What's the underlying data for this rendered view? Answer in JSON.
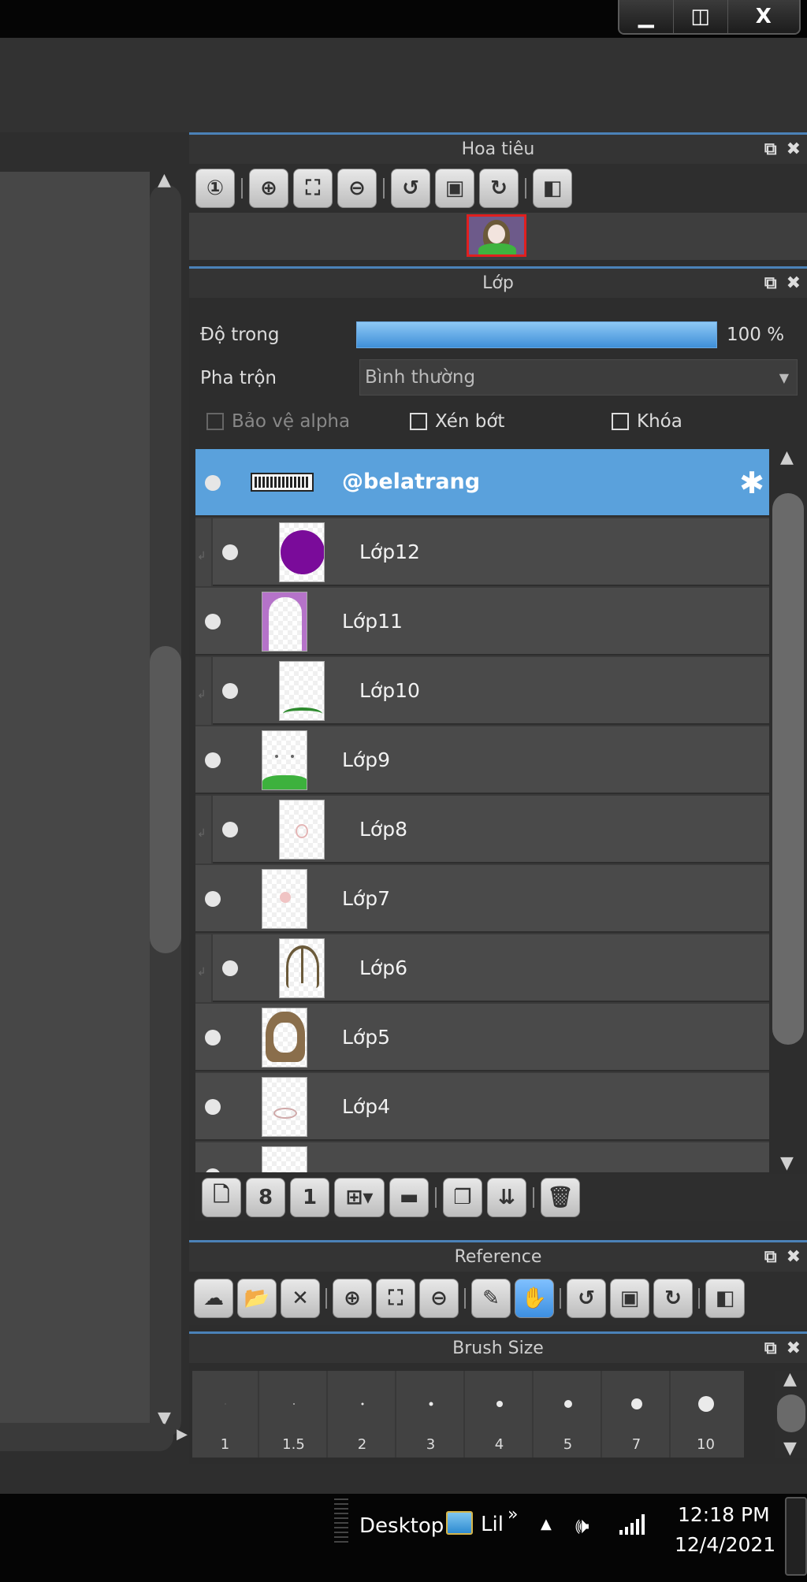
{
  "window": {
    "minimize": "▁",
    "maximize": "◫",
    "close": "X"
  },
  "navigator": {
    "title": "Hoa tiêu"
  },
  "layers": {
    "title": "Lớp",
    "opacity_label": "Độ trong",
    "opacity_value": "100 %",
    "opacity_fraction": 1.0,
    "blend_label": "Pha trộn",
    "blend_value": "Bình thường",
    "protect_alpha": "Bảo vệ alpha",
    "clipping": "Xén bớt",
    "lock": "Khóa",
    "items": [
      {
        "name": "@belatrang",
        "selected": true,
        "clip": false
      },
      {
        "name": "Lớp12",
        "clip": true
      },
      {
        "name": "Lớp11",
        "clip": false
      },
      {
        "name": "Lớp10",
        "clip": true
      },
      {
        "name": "Lớp9",
        "clip": false
      },
      {
        "name": "Lớp8",
        "clip": true
      },
      {
        "name": "Lớp7",
        "clip": false
      },
      {
        "name": "Lớp6",
        "clip": true
      },
      {
        "name": "Lớp5",
        "clip": false
      },
      {
        "name": "Lớp4",
        "clip": false
      }
    ]
  },
  "reference": {
    "title": "Reference"
  },
  "brush_size": {
    "title": "Brush Size",
    "sizes": [
      "1",
      "1.5",
      "2",
      "3",
      "4",
      "5",
      "7",
      "10"
    ]
  },
  "taskbar": {
    "desktop_label": "Desktop",
    "app_label": "Lil",
    "chevron": "»",
    "time": "12:18 PM",
    "date": "12/4/2021"
  }
}
